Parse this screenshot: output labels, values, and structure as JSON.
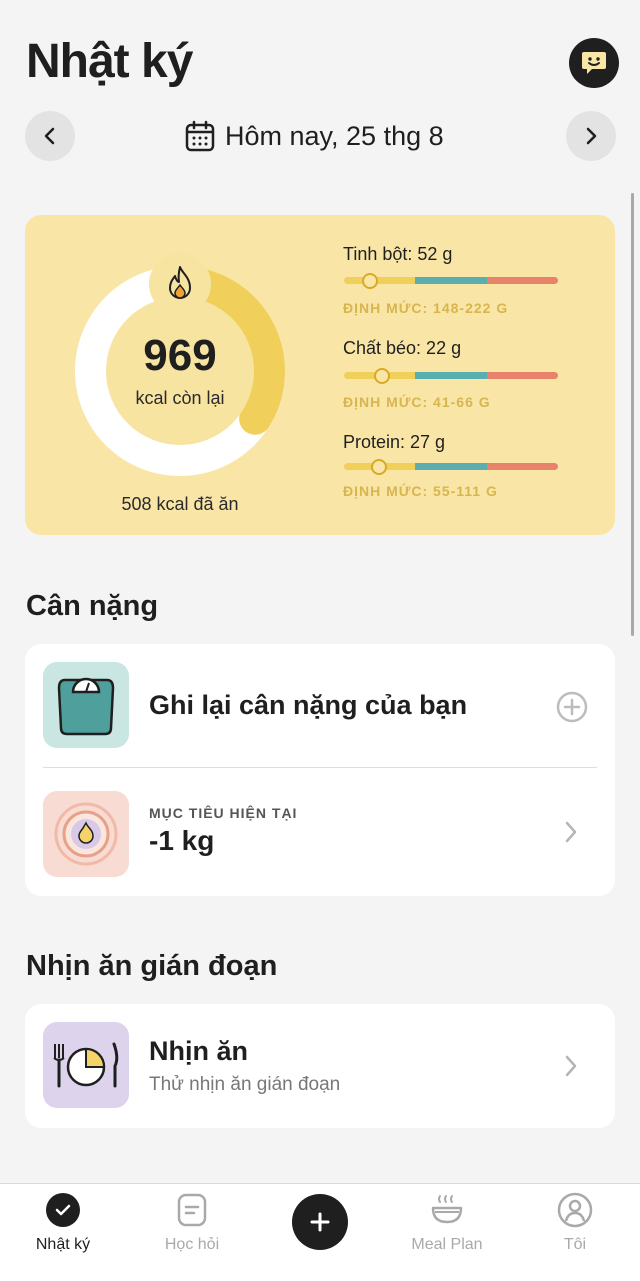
{
  "header": {
    "title": "Nhật ký",
    "date_label": "Hôm nay, 25 thg 8"
  },
  "summary": {
    "remaining_kcal": "969",
    "remaining_label": "kcal còn lại",
    "eaten_label": "508 kcal đã ăn",
    "progress_fraction": 0.34,
    "macros": [
      {
        "label": "Tinh bột: 52 g",
        "range": "ĐỊNH MỨC: 148-222 G",
        "value": 52,
        "min": 148,
        "max": 222
      },
      {
        "label": "Chất béo: 22 g",
        "range": "ĐỊNH MỨC: 41-66 G",
        "value": 22,
        "min": 41,
        "max": 66
      },
      {
        "label": "Protein: 27 g",
        "range": "ĐỊNH MỨC: 55-111 G",
        "value": 27,
        "min": 55,
        "max": 111
      }
    ]
  },
  "weight": {
    "section_title": "Cân nặng",
    "log_label": "Ghi lại cân nặng của bạn",
    "goal_caption": "MỤC TIÊU HIỆN TẠI",
    "goal_value": "-1 kg"
  },
  "fasting": {
    "section_title": "Nhịn ăn gián đoạn",
    "title": "Nhịn ăn",
    "subtitle": "Thử nhịn ăn gián đoạn"
  },
  "nav": {
    "items": [
      {
        "label": "Nhật ký",
        "icon": "check-circle-icon",
        "active": true
      },
      {
        "label": "Học hỏi",
        "icon": "note-icon",
        "active": false
      },
      {
        "label": "",
        "icon": "plus-icon",
        "active": false
      },
      {
        "label": "Meal Plan",
        "icon": "bowl-icon",
        "active": false
      },
      {
        "label": "Tôi",
        "icon": "user-icon",
        "active": false
      }
    ]
  },
  "colors": {
    "card_yellow": "#f9e6a7",
    "ring_yellow": "#f0cf5a",
    "teal": "#5aaeb0",
    "coral": "#e8826a",
    "dark": "#1f1f1f"
  }
}
